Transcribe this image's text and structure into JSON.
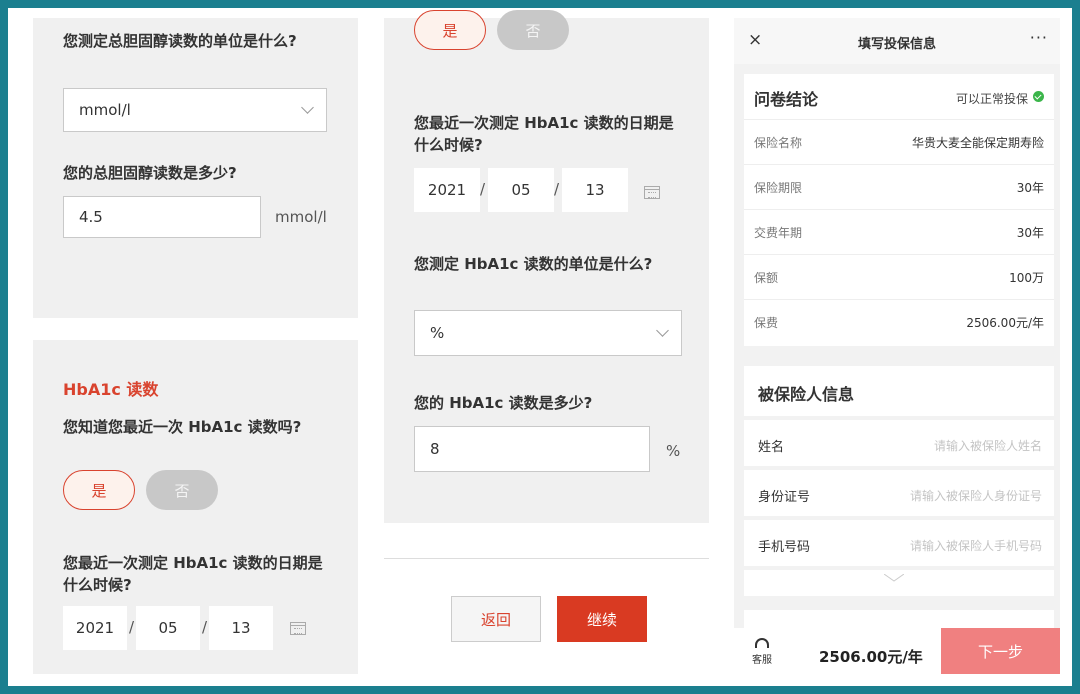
{
  "panel1": {
    "q_unit_total_chol": "您测定总胆固醇读数的单位是什么?",
    "unit_select_value": "mmol/l",
    "q_total_chol_value": "您的总胆固醇读数是多少?",
    "total_chol_value": "4.5",
    "total_chol_unit": "mmol/l",
    "hba1c_title": "HbA1c 读数",
    "q_know_hba1c": "您知道您最近一次 HbA1c 读数吗?",
    "yes_label": "是",
    "no_label": "否",
    "q_hba1c_date": "您最近一次测定 HbA1c 读数的日期是什么时候?",
    "date": {
      "year": "2021",
      "month": "05",
      "day": "13"
    }
  },
  "panel2": {
    "yes_label": "是",
    "no_label": "否",
    "q_hba1c_date": "您最近一次测定 HbA1c 读数的日期是什么时候?",
    "date": {
      "year": "2021",
      "month": "05",
      "day": "13"
    },
    "q_hba1c_unit": "您测定 HbA1c 读数的单位是什么?",
    "unit_select_value": "%",
    "q_hba1c_value": "您的 HbA1c 读数是多少?",
    "hba1c_value": "8",
    "hba1c_unit": "%",
    "back_label": "返回",
    "continue_label": "继续"
  },
  "panel3": {
    "title": "填写投保信息",
    "close_icon": "×",
    "more_icon": "···",
    "conclusion_label": "问卷结论",
    "conclusion_value": "可以正常投保",
    "rows": [
      {
        "label": "保险名称",
        "value": "华贵大麦全能保定期寿险"
      },
      {
        "label": "保险期限",
        "value": "30年"
      },
      {
        "label": "交费年期",
        "value": "30年"
      },
      {
        "label": "保额",
        "value": "100万"
      },
      {
        "label": "保费",
        "value": "2506.00元/年"
      }
    ],
    "insured_heading": "被保险人信息",
    "insured_fields": [
      {
        "label": "姓名",
        "placeholder": "请输入被保险人姓名"
      },
      {
        "label": "身份证号",
        "placeholder": "请输入被保险人身份证号"
      },
      {
        "label": "手机号码",
        "placeholder": "请输入被保险人手机号码"
      }
    ],
    "service_label": "客服",
    "price": "2506.00元/年",
    "next_label": "下一步"
  }
}
